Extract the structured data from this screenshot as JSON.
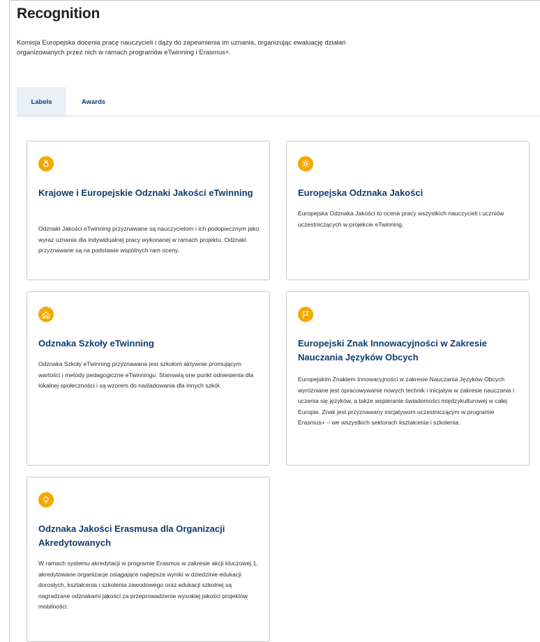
{
  "page": {
    "title": "Recognition",
    "intro": "Komisja Europejska docenia pracę nauczycieli i dąży do zapewnienia im uznania, organizując ewaluację działań organizowanych przez nich w ramach programów eTwinning i Erasmus+."
  },
  "tabs": [
    {
      "label": "Labels",
      "active": true
    },
    {
      "label": "Awards",
      "active": false
    }
  ],
  "colors": {
    "accent": "#f5a800",
    "title": "#0e3d6d",
    "active_tab_bg": "#e8f1f8"
  },
  "cards": [
    {
      "icon": "medal-icon",
      "title": "Krajowe i Europejskie Odznaki Jakości eTwinning",
      "description": "Odznaki Jakości eTwinning przyznawane są nauczycielom i ich podopiecznym jako wyraz uznania dla indywidualnej pracy wykonanej w ramach projektu. Odznaki przyznawane są na podstawie wspólnych ram oceny."
    },
    {
      "icon": "star-burst-icon",
      "title": "Europejska Odznaka Jakości",
      "description": "Europejska Odznaka Jakości to ocena pracy wszystkich nauczycieli i uczniów uczestniczących w projekcie eTwinning."
    },
    {
      "icon": "school-building-icon",
      "title": "Odznaka Szkoły eTwinning",
      "description": "Odznaka Szkoły eTwinning przyznawana jest szkołom aktywnie promującym wartości i metody pedagogiczne eTwinningu. Stanowią one punkt odniesienia dla lokalnej społeczności i są wzorem do naśladowania dla innych szkół."
    },
    {
      "icon": "flag-icon",
      "title": "Europejski Znak Innowacyjności w Zakresie Nauczania Języków Obcych",
      "description": "Europejskim Znakiem Innowacyjności w zakresie Nauczania Języków Obcych wyróżniane jest opracowywanie nowych technik i inicjatyw w zakresie nauczania i uczenia się języków, a także wspieranie świadomości międzykulturowej w całej Europie. Znak jest przyznawany inicjatywom uczestniczącym w programie Erasmus+ – we wszystkich sektorach kształcenia i szkolenia."
    },
    {
      "icon": "lightbulb-icon",
      "title": "Odznaka Jakości Erasmusa dla Organizacji Akredytowanych",
      "description": "W ramach systemu akredytacji w programie Erasmus w zakresie akcji kluczowej 1, akredytowane organizacje osiągające najlepsze wyniki w dziedzinie edukacji dorosłych, kształcenia i szkolenia zawodowego oraz edukacji szkolnej są nagradzane odznakami jakości za przeprowadzenie wysokiej jakości projektów mobilności."
    }
  ]
}
